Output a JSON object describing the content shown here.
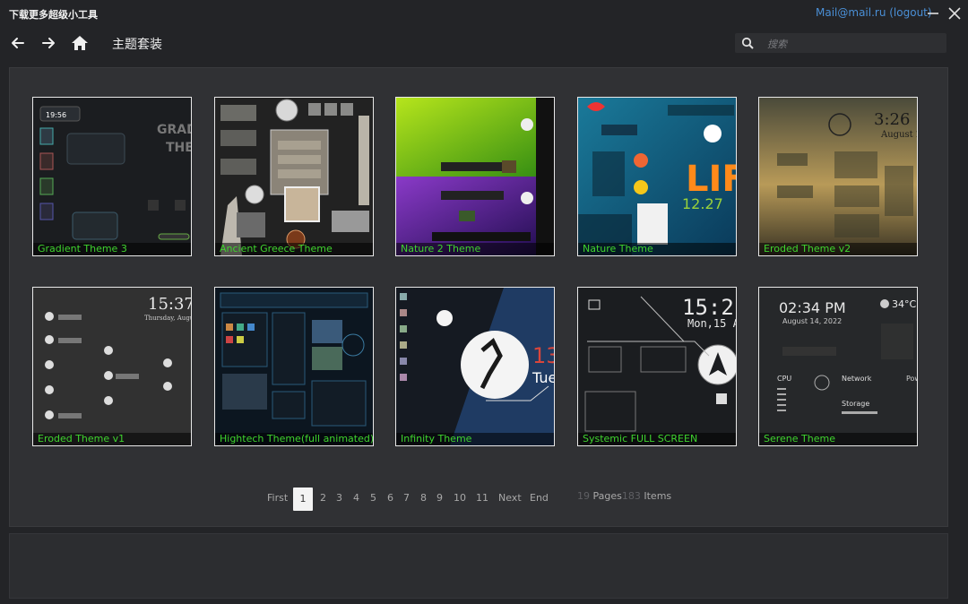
{
  "window": {
    "title": "下载更多超级小工具",
    "account": "Mail@mail.ru (logout)",
    "minimize_icon": "minimize-icon",
    "close_icon": "close-icon"
  },
  "nav": {
    "back_icon": "arrow-left-icon",
    "forward_icon": "arrow-right-icon",
    "home_icon": "home-icon",
    "page_title": "主题套装",
    "search": {
      "placeholder": "搜索",
      "icon": "search-icon"
    }
  },
  "themes": [
    {
      "name": "Gradient Theme 3"
    },
    {
      "name": "Ancient Greece Theme"
    },
    {
      "name": "Nature 2 Theme"
    },
    {
      "name": "Nature Theme"
    },
    {
      "name": "Eroded Theme v2"
    },
    {
      "name": "Eroded Theme v1"
    },
    {
      "name": "Hightech Theme(full animated)"
    },
    {
      "name": "Infinity Theme"
    },
    {
      "name": "Systemic FULL SCREEN"
    },
    {
      "name": "Serene Theme"
    }
  ],
  "pagination": {
    "first": "First",
    "pages": [
      "1",
      "2",
      "3",
      "4",
      "5",
      "6",
      "7",
      "8",
      "9",
      "10",
      "11"
    ],
    "current": "1",
    "next": "Next",
    "end": "End",
    "total_pages": "19",
    "pages_label": "Pages",
    "total_items": "183",
    "items_label": "Items"
  },
  "colors": {
    "caption_text": "#3fd42e",
    "account_link": "#4a8fd6",
    "background": "#232427"
  }
}
